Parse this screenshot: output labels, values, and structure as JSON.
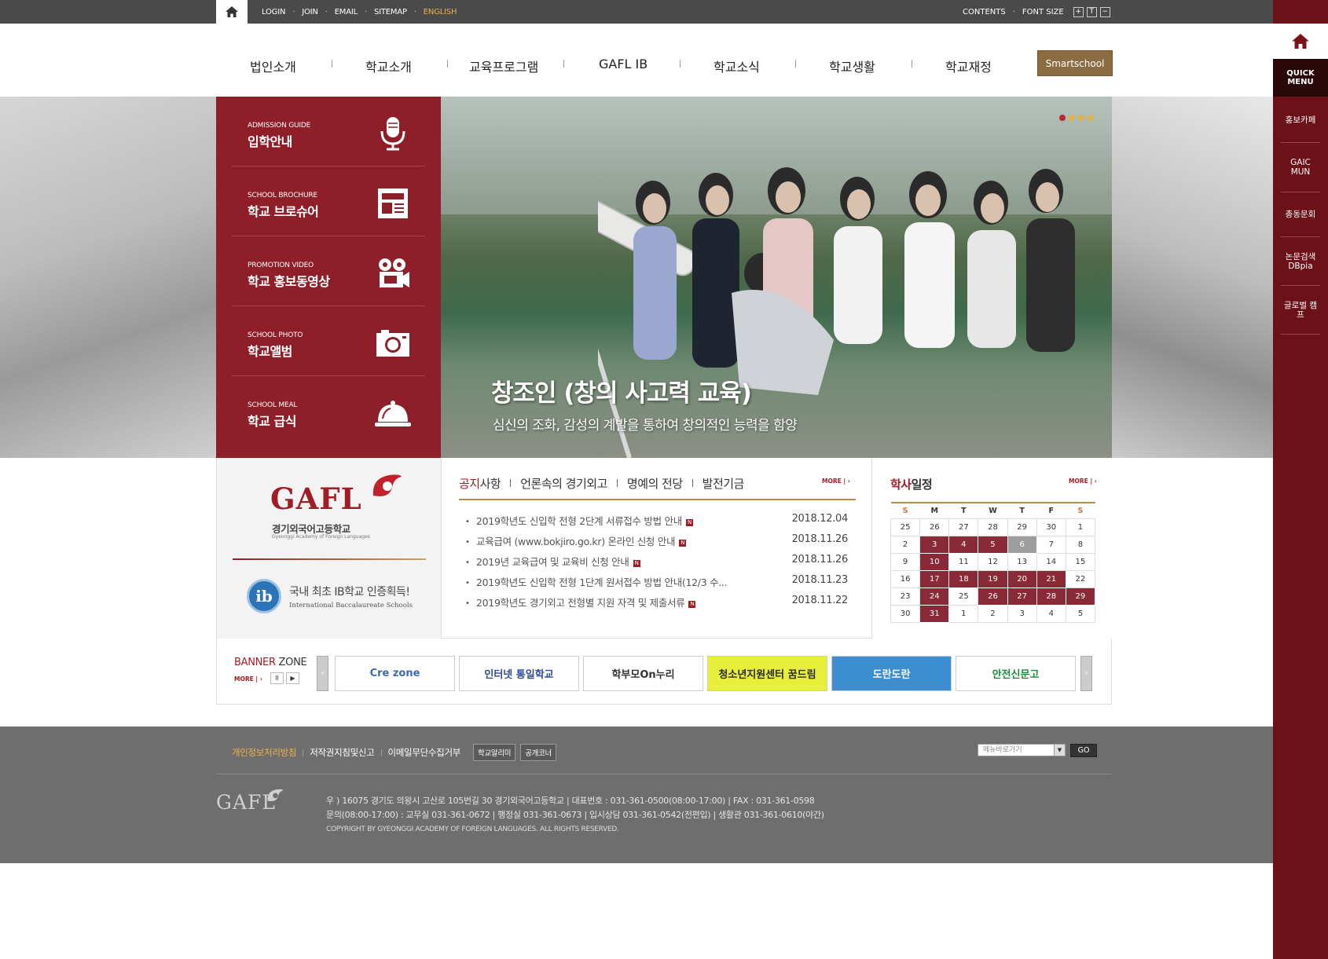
{
  "util_links": {
    "login": "LOGIN",
    "join": "JOIN",
    "email": "EMAIL",
    "sitemap": "SITEMAP",
    "english": "ENGLISH"
  },
  "util_right": {
    "contents": "CONTENTS",
    "font_size": "FONT SIZE",
    "plus": "+",
    "t": "T",
    "minus": "−"
  },
  "gnb": {
    "items": [
      "법인소개",
      "학교소개",
      "교육프로그램",
      "GAFL IB",
      "학교소식",
      "학교생활",
      "학교재정"
    ],
    "smartschool": "Smartschool"
  },
  "quick": {
    "title_1": "QUICK",
    "title_2": "MENU",
    "items": [
      "홍보카페",
      "GAIC MUN",
      "총동문회",
      "논문검색 DBpia",
      "글로벌 캠프"
    ]
  },
  "red_menu": [
    {
      "en": "ADMISSION GUIDE",
      "ko": "입학안내",
      "icon": "microphone-icon"
    },
    {
      "en": "SCHOOL BROCHURE",
      "ko": "학교 브로슈어",
      "icon": "brochure-icon"
    },
    {
      "en": "PROMOTION VIDEO",
      "ko": "학교 홍보동영상",
      "icon": "video-camera-icon"
    },
    {
      "en": "SCHOOL PHOTO",
      "ko": "학교앨범",
      "icon": "camera-icon"
    },
    {
      "en": "SCHOOL MEAL",
      "ko": "학교 급식",
      "icon": "cloche-icon"
    }
  ],
  "visual": {
    "slogan": "창조인 (창의 사고력 교육)",
    "slogan_sub": "심신의 조화, 감성의 계발을 통하여 창의적인 능력을 함양"
  },
  "logo": {
    "gafl": "GAFL",
    "ko": "경기외국어고등학교",
    "en": "Gyeonggi Academy of Foreign Languages",
    "ib_letter": "ib",
    "ib_title": "국내 최초 IB학교 인증획득!",
    "ib_sub": "International Baccalaureate Schools"
  },
  "notice": {
    "tab_first_red": "공지",
    "tab_first_rest": "사항",
    "tabs": [
      "언론속의 경기외고",
      "명예의 전당",
      "발전기금"
    ],
    "more": "MORE | ›",
    "items": [
      {
        "title": "2019학년도 신입학 전형 2단계 서류접수 방법 안내",
        "date": "2018.12.04",
        "new": "N"
      },
      {
        "title": "교육급여 (www.bokjiro.go.kr) 온라인 신청 안내",
        "date": "2018.11.26",
        "new": "N"
      },
      {
        "title": "2019년 교육급여 및 교육비 신청 안내",
        "date": "2018.11.26",
        "new": "N"
      },
      {
        "title": "2019학년도 신입학 전형 1단계 원서접수 방법 안내(12/3 수...",
        "date": "2018.11.23",
        "new": ""
      },
      {
        "title": "2019학년도 경기외고 전형별 지원 자격 및 제출서류",
        "date": "2018.11.22",
        "new": "N"
      }
    ]
  },
  "schedule": {
    "title_red": "학사",
    "title_rest": "일정",
    "more": "MORE | ›",
    "days": [
      "S",
      "M",
      "T",
      "W",
      "T",
      "F",
      "S"
    ],
    "weeks": [
      [
        "25",
        "26",
        "27",
        "28",
        "29",
        "30",
        "1"
      ],
      [
        "2",
        "3",
        "4",
        "5",
        "6",
        "7",
        "8"
      ],
      [
        "9",
        "10",
        "11",
        "12",
        "13",
        "14",
        "15"
      ],
      [
        "16",
        "17",
        "18",
        "19",
        "20",
        "21",
        "22"
      ],
      [
        "23",
        "24",
        "25",
        "26",
        "27",
        "28",
        "29"
      ],
      [
        "30",
        "31",
        "1",
        "2",
        "3",
        "4",
        "5"
      ]
    ],
    "event_cells": [
      "1-1",
      "1-2",
      "1-3",
      "2-1",
      "3-1",
      "3-2",
      "3-3",
      "3-4",
      "3-5",
      "4-1",
      "4-3",
      "4-4",
      "4-5",
      "4-6",
      "5-1"
    ],
    "today_cell": "1-4"
  },
  "banner_zone": {
    "title_red": "BANNER",
    "title_rest": " ZONE",
    "more": "MORE | ›",
    "pause": "II",
    "play": "▶",
    "banners": [
      {
        "text": "Cre zone",
        "bg": "#ffffff",
        "color": "#3a6ab0"
      },
      {
        "text": "인터넷 통일학교",
        "bg": "#ffffff",
        "color": "#2d4b9a"
      },
      {
        "text": "학부모On누리",
        "bg": "#ffffff",
        "color": "#333333"
      },
      {
        "text": "청소년지원센터 꿈드림",
        "bg": "#e8ef3a",
        "color": "#2a2a2a"
      },
      {
        "text": "도란도란",
        "bg": "#3d8ed1",
        "color": "#ffffff"
      },
      {
        "text": "안전신문고",
        "bg": "#ffffff",
        "color": "#1e8a3a"
      }
    ]
  },
  "footer": {
    "links": [
      "개인정보처리방침",
      "저작권지침및신고",
      "이메일무단수집거부"
    ],
    "buttons": [
      "학교알리미",
      "공개코너"
    ],
    "select": "메뉴바로가기",
    "go": "GO",
    "logo": "GAFL",
    "addr1": "우 ) 16075 경기도 의왕시 고산로 105번길 30 경기외국어고등학교   |   대표번호 : 031-361-0500(08:00-17:00)   |   FAX : 031-361-0598",
    "addr2": "문의(08:00-17:00) : 교무실 031-361-0672   |   행정실 031-361-0673   |   입시상담 031-361-0542(전편입)   |   생활관 031-361-0610(야간)",
    "copyright": "COPYRIGHT BY GYEONGGI ACADEMY OF FOREIGN LANGUAGES. ALL RIGHTS RESERVED."
  },
  "colors": {
    "brand_red": "#8e1e27",
    "dark_red": "#6b1117",
    "gold": "#b98e49",
    "footer_gray": "#6e6e6e"
  }
}
